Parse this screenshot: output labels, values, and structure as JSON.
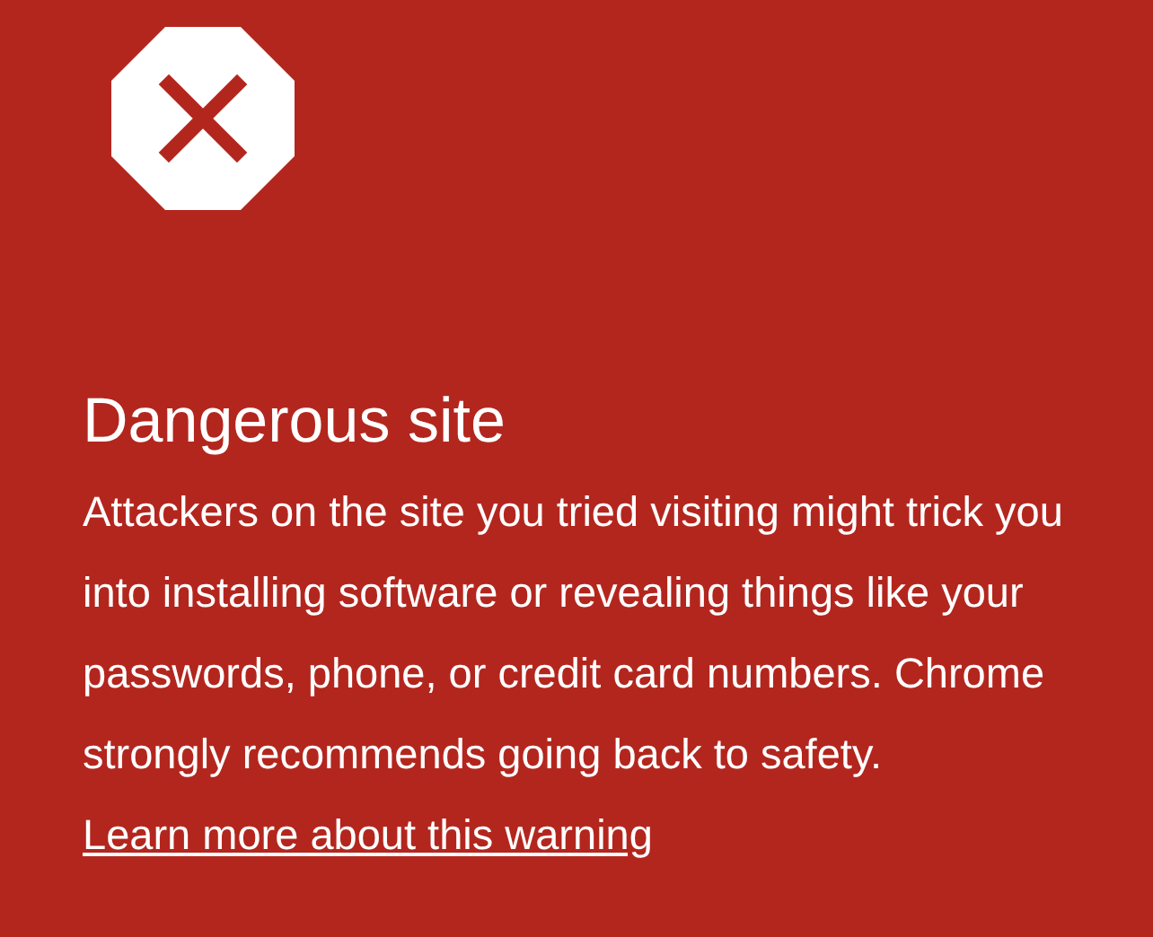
{
  "title": "Dangerous site",
  "message": "Attackers on the site you tried visiting might trick you into installing software or revealing things like your passwords, phone, or credit card numbers. Chrome strongly recommends going back to safety.",
  "link": "Learn more about this warning"
}
